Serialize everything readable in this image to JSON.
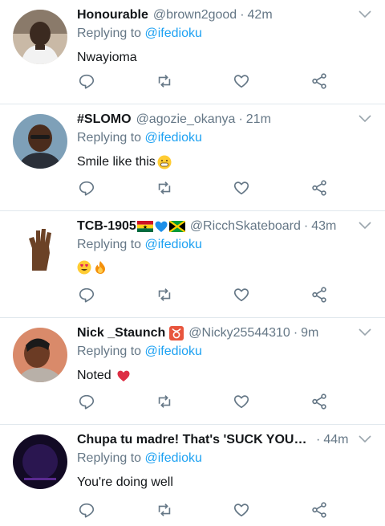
{
  "colors": {
    "link": "#1da1f2",
    "muted": "#657786",
    "text": "#14171a",
    "divider": "#e1e8ed",
    "icon": "#657786"
  },
  "icons": [
    "reply-icon",
    "retweet-icon",
    "like-icon",
    "share-icon",
    "chevron-down-icon"
  ],
  "tweets": [
    {
      "name": "Honourable",
      "handle": "@brown2good",
      "time": "42m",
      "replying_prefix": "Replying to ",
      "replying_to": "@ifedioku",
      "text": "Nwayioma"
    },
    {
      "name": "#SLOMO",
      "handle": "@agozie_okanya",
      "time": "21m",
      "replying_prefix": "Replying to ",
      "replying_to": "@ifedioku",
      "text": "Smile like this"
    },
    {
      "name": "TCB-1905",
      "handle": "@RicchSkateboard",
      "time": "43m",
      "replying_prefix": "Replying to ",
      "replying_to": "@ifedioku",
      "text": ""
    },
    {
      "name": "Nick _Staunch",
      "handle": "@Nicky25544310",
      "time": "9m",
      "replying_prefix": "Replying to ",
      "replying_to": "@ifedioku",
      "text": "Noted"
    },
    {
      "name": "Chupa tu madre! That's 'SUCK YOUR M...",
      "handle": "",
      "time": "44m",
      "replying_prefix": "Replying to ",
      "replying_to": "@ifedioku",
      "text": "You're doing well"
    }
  ]
}
